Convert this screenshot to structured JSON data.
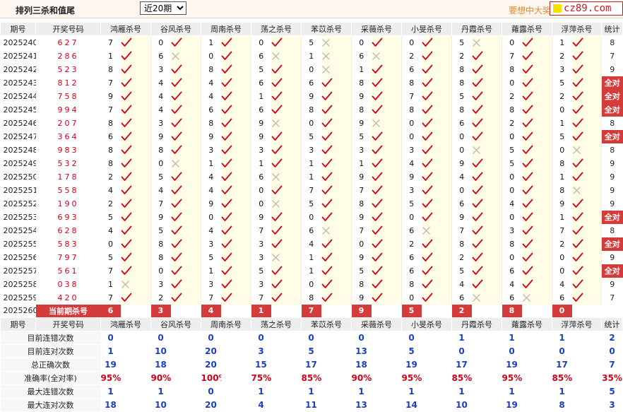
{
  "header": {
    "title": "排列三杀和值尾",
    "select_value": "近20期",
    "promo": "要想中大奖",
    "logo_text": "cz89.com"
  },
  "columns": [
    "期号",
    "开奖号码",
    "鸿雁杀号",
    "谷风杀号",
    "周南杀号",
    "荡之杀号",
    "苯苡杀号",
    "采薇杀号",
    "小旻杀号",
    "丹霞杀号",
    "蕹露杀号",
    "浮萍杀号",
    "统计"
  ],
  "rows": [
    {
      "period": "2025240",
      "draw": "627",
      "kills": [
        [
          "7",
          1
        ],
        [
          "0",
          1
        ],
        [
          "1",
          1
        ],
        [
          "0",
          1
        ],
        [
          "5",
          0
        ],
        [
          "0",
          1
        ],
        [
          "0",
          1
        ],
        [
          "5",
          0
        ],
        [
          "0",
          1
        ],
        [
          "1",
          1
        ]
      ],
      "stat": "8"
    },
    {
      "period": "2025241",
      "draw": "286",
      "kills": [
        [
          "1",
          1
        ],
        [
          "6",
          0
        ],
        [
          "0",
          1
        ],
        [
          "6",
          0
        ],
        [
          "1",
          0
        ],
        [
          "6",
          0
        ],
        [
          "2",
          1
        ],
        [
          "2",
          1
        ],
        [
          "7",
          1
        ],
        [
          "2",
          1
        ]
      ],
      "stat": "7"
    },
    {
      "period": "2025242",
      "draw": "523",
      "kills": [
        [
          "8",
          1
        ],
        [
          "3",
          1
        ],
        [
          "8",
          1
        ],
        [
          "5",
          1
        ],
        [
          "0",
          0
        ],
        [
          "1",
          1
        ],
        [
          "6",
          1
        ],
        [
          "8",
          1
        ],
        [
          "8",
          1
        ],
        [
          "3",
          1
        ]
      ],
      "stat": "9"
    },
    {
      "period": "2025243",
      "draw": "812",
      "kills": [
        [
          "7",
          1
        ],
        [
          "4",
          1
        ],
        [
          "4",
          1
        ],
        [
          "6",
          1
        ],
        [
          "6",
          1
        ],
        [
          "8",
          1
        ],
        [
          "8",
          1
        ],
        [
          "8",
          1
        ],
        [
          "0",
          1
        ],
        [
          "5",
          1
        ]
      ],
      "stat": "全对"
    },
    {
      "period": "2025244",
      "draw": "758",
      "kills": [
        [
          "9",
          1
        ],
        [
          "4",
          1
        ],
        [
          "4",
          1
        ],
        [
          "1",
          1
        ],
        [
          "9",
          1
        ],
        [
          "9",
          1
        ],
        [
          "7",
          1
        ],
        [
          "5",
          1
        ],
        [
          "2",
          1
        ],
        [
          "2",
          1
        ]
      ],
      "stat": "全对"
    },
    {
      "period": "2025245",
      "draw": "994",
      "kills": [
        [
          "7",
          1
        ],
        [
          "4",
          1
        ],
        [
          "6",
          1
        ],
        [
          "6",
          1
        ],
        [
          "8",
          1
        ],
        [
          "8",
          1
        ],
        [
          "8",
          1
        ],
        [
          "8",
          1
        ],
        [
          "8",
          1
        ],
        [
          "0",
          1
        ]
      ],
      "stat": "全对"
    },
    {
      "period": "2025246",
      "draw": "207",
      "kills": [
        [
          "8",
          1
        ],
        [
          "3",
          1
        ],
        [
          "8",
          1
        ],
        [
          "9",
          0
        ],
        [
          "0",
          1
        ],
        [
          "9",
          0
        ],
        [
          "0",
          1
        ],
        [
          "6",
          1
        ],
        [
          "2",
          1
        ],
        [
          "1",
          1
        ]
      ],
      "stat": "8"
    },
    {
      "period": "2025247",
      "draw": "364",
      "kills": [
        [
          "6",
          1
        ],
        [
          "9",
          1
        ],
        [
          "9",
          1
        ],
        [
          "9",
          1
        ],
        [
          "5",
          1
        ],
        [
          "5",
          1
        ],
        [
          "0",
          1
        ],
        [
          "0",
          1
        ],
        [
          "0",
          1
        ],
        [
          "5",
          1
        ]
      ],
      "stat": "全对"
    },
    {
      "period": "2025248",
      "draw": "983",
      "kills": [
        [
          "8",
          1
        ],
        [
          "8",
          1
        ],
        [
          "3",
          1
        ],
        [
          "3",
          1
        ],
        [
          "3",
          1
        ],
        [
          "3",
          1
        ],
        [
          "3",
          1
        ],
        [
          "0",
          0
        ],
        [
          "5",
          1
        ],
        [
          "0",
          0
        ]
      ],
      "stat": "8"
    },
    {
      "period": "2025249",
      "draw": "532",
      "kills": [
        [
          "8",
          1
        ],
        [
          "0",
          0
        ],
        [
          "1",
          1
        ],
        [
          "1",
          1
        ],
        [
          "1",
          1
        ],
        [
          "1",
          1
        ],
        [
          "4",
          1
        ],
        [
          "9",
          1
        ],
        [
          "5",
          1
        ],
        [
          "8",
          1
        ]
      ],
      "stat": "9"
    },
    {
      "period": "2025250",
      "draw": "178",
      "kills": [
        [
          "2",
          1
        ],
        [
          "5",
          1
        ],
        [
          "4",
          1
        ],
        [
          "6",
          0
        ],
        [
          "1",
          1
        ],
        [
          "9",
          1
        ],
        [
          "9",
          1
        ],
        [
          "4",
          1
        ],
        [
          "0",
          1
        ],
        [
          "1",
          1
        ]
      ],
      "stat": "9"
    },
    {
      "period": "2025251",
      "draw": "558",
      "kills": [
        [
          "4",
          1
        ],
        [
          "4",
          1
        ],
        [
          "4",
          1
        ],
        [
          "0",
          1
        ],
        [
          "7",
          1
        ],
        [
          "7",
          1
        ],
        [
          "3",
          1
        ],
        [
          "0",
          1
        ],
        [
          "0",
          1
        ],
        [
          "8",
          0
        ]
      ],
      "stat": "9"
    },
    {
      "period": "2025252",
      "draw": "190",
      "kills": [
        [
          "2",
          1
        ],
        [
          "7",
          1
        ],
        [
          "9",
          1
        ],
        [
          "0",
          0
        ],
        [
          "5",
          1
        ],
        [
          "8",
          1
        ],
        [
          "5",
          1
        ],
        [
          "6",
          1
        ],
        [
          "4",
          1
        ],
        [
          "9",
          1
        ]
      ],
      "stat": "9"
    },
    {
      "period": "2025253",
      "draw": "693",
      "kills": [
        [
          "5",
          1
        ],
        [
          "9",
          1
        ],
        [
          "0",
          1
        ],
        [
          "9",
          1
        ],
        [
          "0",
          1
        ],
        [
          "9",
          1
        ],
        [
          "0",
          1
        ],
        [
          "9",
          1
        ],
        [
          "0",
          1
        ],
        [
          "1",
          1
        ]
      ],
      "stat": "全对"
    },
    {
      "period": "2025254",
      "draw": "628",
      "kills": [
        [
          "4",
          1
        ],
        [
          "5",
          1
        ],
        [
          "4",
          1
        ],
        [
          "7",
          1
        ],
        [
          "6",
          0
        ],
        [
          "7",
          1
        ],
        [
          "6",
          0
        ],
        [
          "7",
          1
        ],
        [
          "3",
          1
        ],
        [
          "7",
          1
        ]
      ],
      "stat": "8"
    },
    {
      "period": "2025255",
      "draw": "583",
      "kills": [
        [
          "0",
          1
        ],
        [
          "8",
          1
        ],
        [
          "3",
          1
        ],
        [
          "3",
          1
        ],
        [
          "4",
          1
        ],
        [
          "0",
          1
        ],
        [
          "2",
          1
        ],
        [
          "8",
          1
        ],
        [
          "8",
          1
        ],
        [
          "2",
          1
        ]
      ],
      "stat": "全对"
    },
    {
      "period": "2025256",
      "draw": "797",
      "kills": [
        [
          "5",
          1
        ],
        [
          "8",
          1
        ],
        [
          "5",
          1
        ],
        [
          "3",
          0
        ],
        [
          "1",
          1
        ],
        [
          "9",
          1
        ],
        [
          "6",
          1
        ],
        [
          "2",
          1
        ],
        [
          "0",
          1
        ],
        [
          "0",
          1
        ]
      ],
      "stat": "9"
    },
    {
      "period": "2025257",
      "draw": "561",
      "kills": [
        [
          "7",
          1
        ],
        [
          "0",
          1
        ],
        [
          "1",
          1
        ],
        [
          "5",
          1
        ],
        [
          "1",
          1
        ],
        [
          "5",
          1
        ],
        [
          "6",
          1
        ],
        [
          "5",
          1
        ],
        [
          "6",
          1
        ],
        [
          "0",
          1
        ]
      ],
      "stat": "全对"
    },
    {
      "period": "2025258",
      "draw": "038",
      "kills": [
        [
          "1",
          0
        ],
        [
          "3",
          1
        ],
        [
          "3",
          1
        ],
        [
          "3",
          1
        ],
        [
          "0",
          1
        ],
        [
          "8",
          1
        ],
        [
          "8",
          1
        ],
        [
          "4",
          1
        ],
        [
          "4",
          1
        ],
        [
          "4",
          1
        ]
      ],
      "stat": "9"
    },
    {
      "period": "2025259",
      "draw": "420",
      "kills": [
        [
          "7",
          1
        ],
        [
          "2",
          1
        ],
        [
          "7",
          1
        ],
        [
          "7",
          1
        ],
        [
          "8",
          1
        ],
        [
          "9",
          1
        ],
        [
          "0",
          1
        ],
        [
          "6",
          0
        ],
        [
          "6",
          0
        ],
        [
          "6",
          1
        ]
      ],
      "stat": "7"
    }
  ],
  "current": {
    "period": "2025260",
    "label": "当前期杀号",
    "kills": [
      "6",
      "3",
      "4",
      "1",
      "7",
      "9",
      "5",
      "2",
      "8",
      "0"
    ]
  },
  "summary": [
    {
      "label": "目前连错次数",
      "values": [
        "0",
        "0",
        "0",
        "0",
        "0",
        "0",
        "0",
        "1",
        "1",
        "1",
        "2"
      ]
    },
    {
      "label": "目前连对次数",
      "values": [
        "1",
        "10",
        "20",
        "3",
        "5",
        "13",
        "5",
        "0",
        "0",
        "0",
        "0"
      ]
    },
    {
      "label": "总正确次数",
      "values": [
        "19",
        "18",
        "20",
        "15",
        "17",
        "18",
        "19",
        "17",
        "19",
        "17",
        "7"
      ]
    },
    {
      "label": "准确率(全对率)",
      "values": [
        "95%",
        "90%",
        "100%",
        "75%",
        "85%",
        "90%",
        "95%",
        "85%",
        "95%",
        "85%",
        "35%"
      ]
    },
    {
      "label": "最大连错次数",
      "values": [
        "1",
        "1",
        "0",
        "1",
        "1",
        "1",
        "1",
        "1",
        "1",
        "1",
        "5"
      ]
    },
    {
      "label": "最大连对次数",
      "values": [
        "18",
        "10",
        "20",
        "4",
        "11",
        "13",
        "14",
        "10",
        "19",
        "8",
        "3"
      ]
    }
  ],
  "colors": {
    "check": "#d0021b",
    "cross": "#bdbdbd",
    "full": "#d43c3c",
    "blue": "#1a3fbf"
  }
}
